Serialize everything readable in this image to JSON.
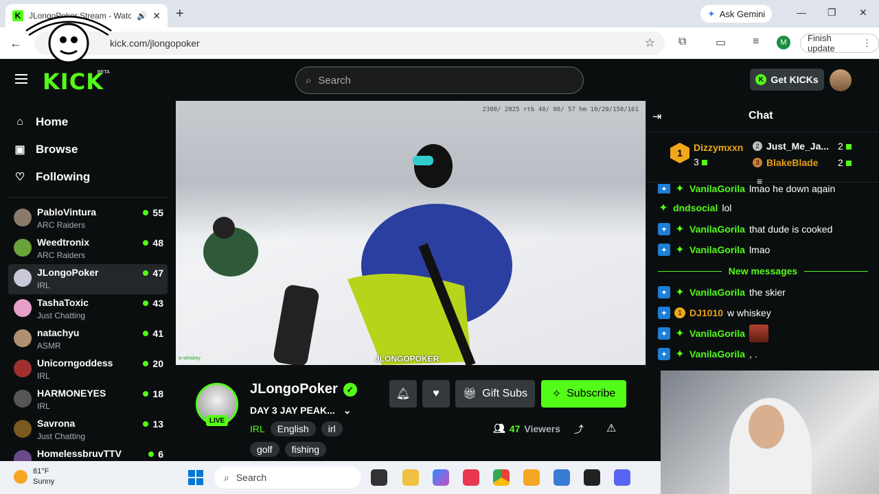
{
  "browser": {
    "tab_title": "JLongoPoker Stream - Watch",
    "url": "kick.com/jlongopoker",
    "ask_gemini": "Ask Gemini",
    "finish_update": "Finish update",
    "profile_initial": "M"
  },
  "kick": {
    "logo": "KICK",
    "beta": "BETA",
    "search_placeholder": "Search",
    "get_kicks": "Get KICKs"
  },
  "nav": [
    {
      "label": "Home",
      "icon": "home-icon"
    },
    {
      "label": "Browse",
      "icon": "browse-icon"
    },
    {
      "label": "Following",
      "icon": "heart-icon"
    }
  ],
  "channels": [
    {
      "name": "PabloVintura",
      "category": "ARC Raiders",
      "viewers": "55",
      "color": "#8a7a6a"
    },
    {
      "name": "Weedtronix",
      "category": "ARC Raiders",
      "viewers": "48",
      "color": "#6aa33a"
    },
    {
      "name": "JLongoPoker",
      "category": "IRL",
      "viewers": "47",
      "color": "#c8c8d8"
    },
    {
      "name": "TashaToxic",
      "category": "Just Chatting",
      "viewers": "43",
      "color": "#e6a0c8"
    },
    {
      "name": "natachyu",
      "category": "ASMR",
      "viewers": "41",
      "color": "#b09070"
    },
    {
      "name": "Unicorngoddess",
      "category": "IRL",
      "viewers": "20",
      "color": "#a03030"
    },
    {
      "name": "HARMONEYES",
      "category": "IRL",
      "viewers": "18",
      "color": "#555555"
    },
    {
      "name": "Savrona",
      "category": "Just Chatting",
      "viewers": "13",
      "color": "#7a5a20"
    },
    {
      "name": "HomelessbruvTTV",
      "category": "",
      "viewers": "6",
      "color": "#6a4a8a"
    }
  ],
  "video": {
    "timestamp": "2300/ 2025 rtb 40/ 00/ 57 hm 10/20/150/161",
    "watermark": "JLONGOPOKER",
    "overlay_chat": "w whiskey"
  },
  "stream": {
    "streamer": "JLongoPoker",
    "live": "LIVE",
    "title": "DAY 3 JAY PEAK...",
    "category": "IRL",
    "tags": [
      "English",
      "irl"
    ],
    "tags2": [
      "golf",
      "fishing"
    ],
    "gift_subs": "Gift Subs",
    "subscribe": "Subscribe",
    "viewers_count": "47",
    "viewers_label": "Viewers"
  },
  "chat": {
    "title": "Chat",
    "leaderboard": {
      "first": {
        "rank": "1",
        "name": "Dizzymxxn",
        "count": "3"
      },
      "second": {
        "rank": "2",
        "name": "Just_Me_Ja...",
        "count": "2"
      },
      "third": {
        "rank": "3",
        "name": "BlakeBlade",
        "count": "2"
      }
    },
    "messages": [
      {
        "user": "VanilaGorila",
        "text": "lmao he down again"
      },
      {
        "user": "dndsocial",
        "text": "lol"
      },
      {
        "user": "VanilaGorila",
        "text": "that dude is cooked"
      },
      {
        "user": "VanilaGorila",
        "text": "lmao"
      }
    ],
    "new_messages": "New messages",
    "messages2": [
      {
        "user": "VanilaGorila",
        "text": "the skier"
      },
      {
        "user": "DJ1010",
        "text": "w whiskey"
      },
      {
        "user": "VanilaGorila",
        "text": ""
      },
      {
        "user": "VanilaGorila",
        "text": ", ."
      }
    ]
  },
  "taskbar": {
    "temp": "81°F",
    "condition": "Sunny",
    "search": "Search"
  }
}
